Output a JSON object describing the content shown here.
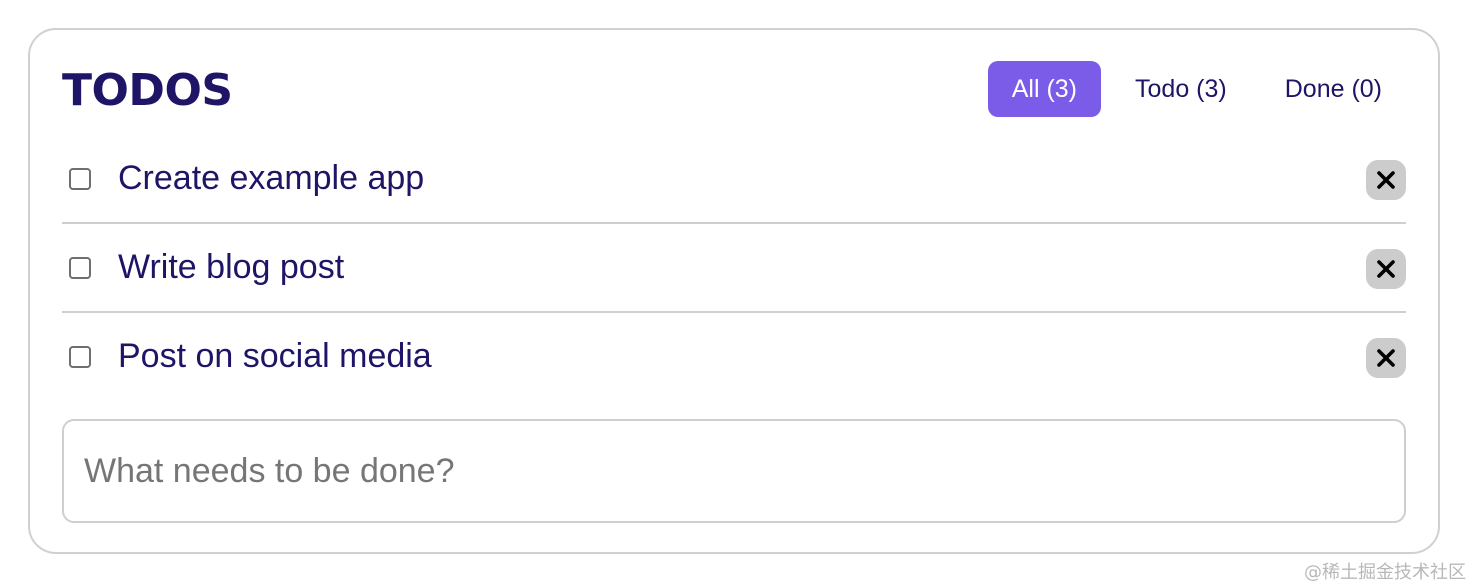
{
  "header": {
    "title": "TODOS"
  },
  "filters": [
    {
      "label": "All (3)",
      "active": true
    },
    {
      "label": "Todo (3)",
      "active": false
    },
    {
      "label": "Done (0)",
      "active": false
    }
  ],
  "todos": [
    {
      "text": "Create example app",
      "done": false
    },
    {
      "text": "Write blog post",
      "done": false
    },
    {
      "text": "Post on social media",
      "done": false
    }
  ],
  "new_todo": {
    "placeholder": "What needs to be done?",
    "value": ""
  },
  "watermark": "@稀土掘金技术社区",
  "colors": {
    "accent": "#7b5ce9",
    "text": "#1f1566",
    "delete_bg": "#cccccc",
    "border": "#d0d0d0"
  },
  "icons": {
    "delete": "close-icon",
    "checkbox": "checkbox"
  }
}
